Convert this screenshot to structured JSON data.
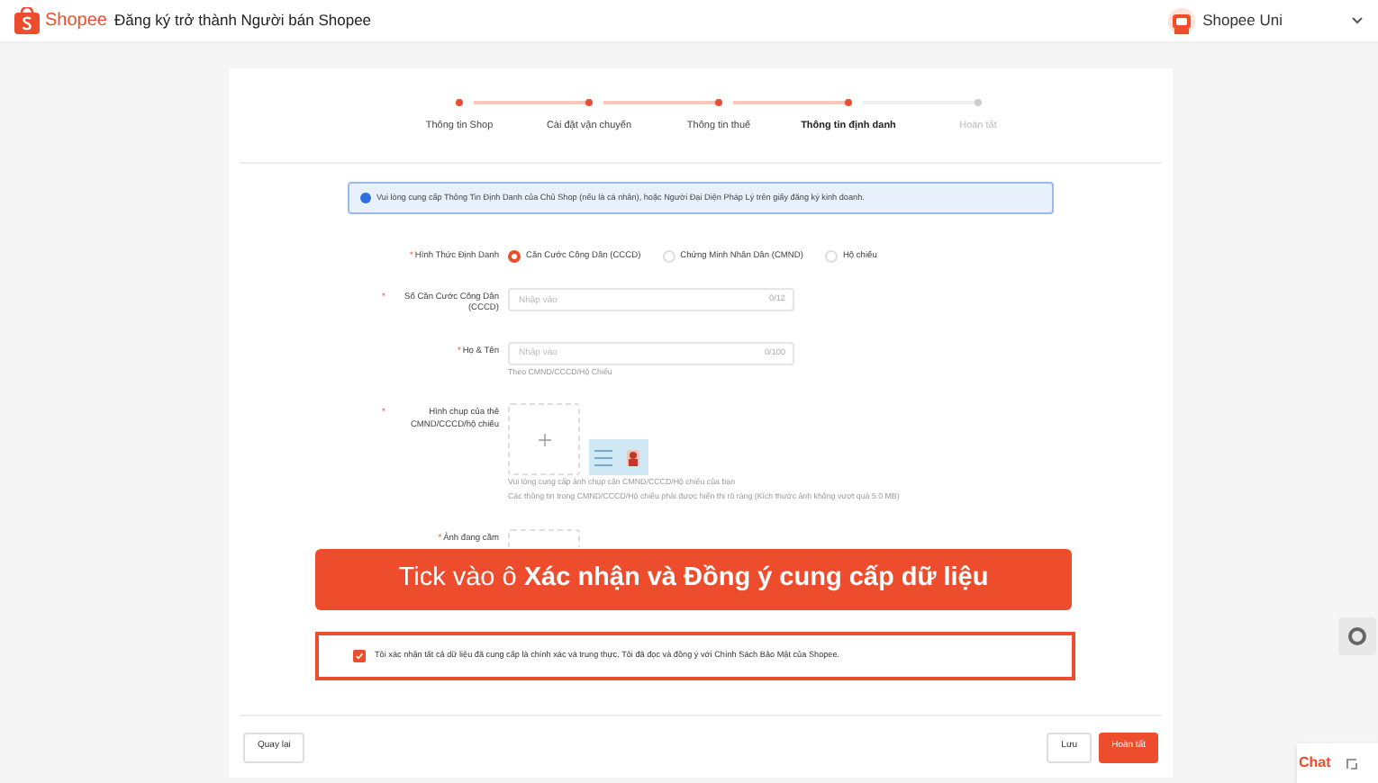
{
  "header": {
    "brand": "Shopee",
    "title": "Đăng ký trở thành Người bán Shopee",
    "account": "Shopee Uni"
  },
  "steps": [
    {
      "label": "Thông tin Shop",
      "completed": true,
      "selected": false
    },
    {
      "label": "Cài đặt vận chuyển",
      "completed": true,
      "selected": false
    },
    {
      "label": "Thông tin thuế",
      "completed": true,
      "selected": false
    },
    {
      "label": "Thông tin định danh",
      "completed": false,
      "selected": true
    },
    {
      "label": "Hoàn tất",
      "completed": false,
      "selected": false
    }
  ],
  "notice": "Vui lòng cung cấp Thông Tin Định Danh của Chủ Shop (nếu là cá nhân), hoặc Người Đại Diện Pháp Lý trên giấy đăng ký kinh doanh.",
  "form": [
    {
      "kind": "radio",
      "required_mark": "*",
      "label": "Hình Thức Định Danh",
      "options": [
        {
          "label": "Căn Cước Công Dân (CCCD)",
          "selected": true
        },
        {
          "label": "Chứng Minh Nhân Dân (CMND)",
          "selected": false
        },
        {
          "label": "Hộ chiếu",
          "selected": false
        }
      ]
    },
    {
      "kind": "text",
      "required_mark": "*",
      "label": "Số Căn Cước Công Dân (CCCD)",
      "placeholder": "Nhập vào",
      "counter": "0/12"
    },
    {
      "kind": "text",
      "required_mark": "*",
      "label": "Họ & Tên",
      "placeholder": "Nhập vào",
      "counter": "0/100",
      "hint": "Theo CMND/CCCD/Hộ Chiếu"
    },
    {
      "kind": "upload_sample",
      "required_mark": "*",
      "label": "Hình chụp của thẻ CMND/CCCD/hộ chiếu",
      "hints": [
        "Vui lòng cung cấp ảnh chụp cận CMND/CCCD/Hộ chiếu của bạn",
        "Các thông tin trong CMND/CCCD/Hộ chiếu phải được hiển thị rõ ràng (Kích thước ảnh không vượt quá 5.0 MB)"
      ]
    },
    {
      "kind": "upload",
      "required_mark": "*",
      "label": "Ảnh đang cầm"
    }
  ],
  "callout": "Tick vào ô **Xác nhận và Đồng ý cung cấp dữ liệu**",
  "consent": {
    "text": "Tôi xác nhận tất cả dữ liệu đã cung cấp là chính xác và trung thực. Tôi đã đọc và đồng ý với Chính Sách Bảo Mật của Shopee.",
    "checked": true
  },
  "buttons": {
    "back": "Quay lại",
    "save": "Lưu",
    "finish": "Hoàn tất"
  },
  "chat": "Chat"
}
